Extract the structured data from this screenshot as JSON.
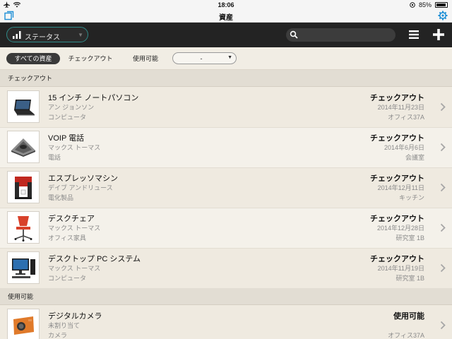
{
  "status_bar": {
    "time": "18:06",
    "battery": "85%"
  },
  "nav": {
    "title": "資産"
  },
  "toolbar": {
    "status_dropdown": "ステータス"
  },
  "filters": {
    "all": "すべての資産",
    "checkout": "チェックアウト",
    "available": "使用可能",
    "select_value": "-"
  },
  "sections": {
    "checkout": "チェックアウト",
    "available": "使用可能"
  },
  "items": [
    {
      "name": "15 インチ ノートパソコン",
      "person": "アン ジョンソン",
      "category": "コンピュータ",
      "status": "チェックアウト",
      "date": "2014年11月23日",
      "location": "オフィス37A"
    },
    {
      "name": "VOIP 電話",
      "person": "マックス トーマス",
      "category": "電話",
      "status": "チェックアウト",
      "date": "2014年6月6日",
      "location": "会議室"
    },
    {
      "name": "エスプレッソマシン",
      "person": "デイブ アンドリュース",
      "category": "電化製品",
      "status": "チェックアウト",
      "date": "2014年12月11日",
      "location": "キッチン"
    },
    {
      "name": "デスクチェア",
      "person": "マックス トーマス",
      "category": "オフィス家具",
      "status": "チェックアウト",
      "date": "2014年12月28日",
      "location": "研究室 1B"
    },
    {
      "name": "デスクトップ PC システム",
      "person": "マックス トーマス",
      "category": "コンピュータ",
      "status": "チェックアウト",
      "date": "2014年11月19日",
      "location": "研究室 1B"
    },
    {
      "name": "デジタルカメラ",
      "person": "未割り当て",
      "category": "カメラ",
      "status": "使用可能",
      "date": "",
      "location": "オフィス37A"
    }
  ],
  "colors": {
    "accent": "#1e8fd6",
    "toolbar": "#232323",
    "teal_outline": "#2f8a88"
  }
}
